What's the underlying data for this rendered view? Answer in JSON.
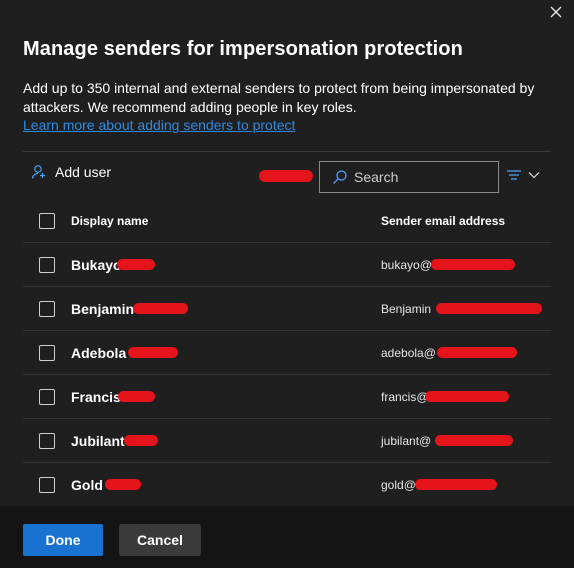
{
  "dialog": {
    "title": "Manage senders for impersonation protection",
    "description": "Add up to 350 internal and external senders to protect from being impersonated by attackers. We recommend adding people in key roles.",
    "learn_more": "Learn more about adding senders to protect"
  },
  "toolbar": {
    "add_user": "Add user",
    "search_placeholder": "Search"
  },
  "table": {
    "columns": {
      "name": "Display name",
      "email": "Sender email address"
    },
    "rows": [
      {
        "name": "Bukayo",
        "email": "bukayo@"
      },
      {
        "name": "Benjamin",
        "email": "Benjamin"
      },
      {
        "name": "Adebola",
        "email": "adebola@"
      },
      {
        "name": "Francis",
        "email": "francis@"
      },
      {
        "name": "Jubilant",
        "email": "jubilant@"
      },
      {
        "name": "Gold",
        "email": "gold@"
      }
    ]
  },
  "footer": {
    "done_label": "Done",
    "cancel_label": "Cancel"
  },
  "colors": {
    "background": "#1f1f1f",
    "primary": "#1a72d0",
    "link": "#2f8ae0",
    "redaction": "#e5141b"
  }
}
